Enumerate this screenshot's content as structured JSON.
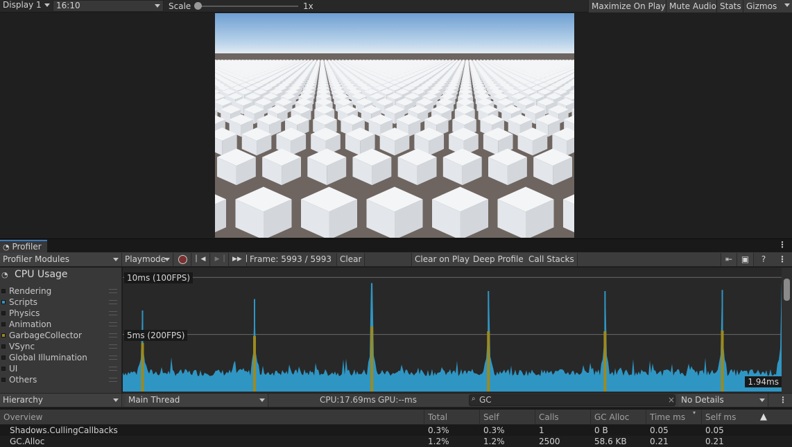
{
  "topbar": {
    "display": "Display 1",
    "aspect": "16:10",
    "scale_label": "Scale",
    "scale_value": "1x",
    "scale_level": 0.0,
    "maximize": "Maximize On Play",
    "mute": "Mute Audio",
    "stats": "Stats",
    "gizmos": "Gizmos"
  },
  "profiler": {
    "tab": "Profiler",
    "modules_dropdown": "Profiler Modules",
    "target": "Playmode",
    "frame": "Frame: 5993 / 5993",
    "clear": "Clear",
    "clear_on_play": "Clear on Play",
    "deep_profile": "Deep Profile",
    "call_stacks": "Call Stacks",
    "icons": [
      "record-icon",
      "first-frame-icon",
      "next-frame-icon",
      "last-frame-icon",
      "load-icon",
      "save-icon",
      "help-icon",
      "more-icon"
    ]
  },
  "modules": {
    "title": "CPU Usage",
    "items": [
      {
        "label": "Rendering",
        "color": "#1e1e1e"
      },
      {
        "label": "Scripts",
        "color": "#2f96c4"
      },
      {
        "label": "Physics",
        "color": "#1e1e1e"
      },
      {
        "label": "Animation",
        "color": "#1e1e1e"
      },
      {
        "label": "GarbageCollector",
        "color": "#9c8a1f"
      },
      {
        "label": "VSync",
        "color": "#1e1e1e"
      },
      {
        "label": "Global Illumination",
        "color": "#1e1e1e"
      },
      {
        "label": "UI",
        "color": "#1e1e1e"
      },
      {
        "label": "Others",
        "color": "#1e1e1e"
      }
    ]
  },
  "chart_data": {
    "type": "area",
    "title": "CPU Usage",
    "series": [
      {
        "name": "Scripts",
        "color": "#2f96c4"
      },
      {
        "name": "GarbageCollector",
        "color": "#9c8a1f"
      }
    ],
    "guides": [
      {
        "label": "10ms (100FPS)",
        "value": 10
      },
      {
        "label": "5ms (200FPS)",
        "value": 5
      }
    ],
    "spikes_ms": [
      7.1,
      8.1,
      9.5,
      8.8,
      8.8,
      8.9,
      9.7
    ],
    "spike_positions": [
      0.03,
      0.2,
      0.378,
      0.555,
      0.732,
      0.91,
      1.0
    ],
    "baseline_ms": 1.8,
    "current_label": "1.94ms",
    "ylim": [
      0,
      10.5
    ]
  },
  "hierarchy": {
    "view": "Hierarchy",
    "thread": "Main Thread",
    "cpu": "CPU:17.69ms",
    "gpu": "GPU:--ms",
    "search": "GC",
    "details": "No Details"
  },
  "table": {
    "columns": [
      "Overview",
      "Total",
      "Self",
      "Calls",
      "GC Alloc",
      "Time ms",
      "Self ms"
    ],
    "rows": [
      [
        "Shadows.CullingCallbacks",
        "0.3%",
        "0.3%",
        "1",
        "0 B",
        "0.05",
        "0.05"
      ],
      [
        "GC.Alloc",
        "1.2%",
        "1.2%",
        "2500",
        "58.6 KB",
        "0.21",
        "0.21"
      ]
    ]
  }
}
